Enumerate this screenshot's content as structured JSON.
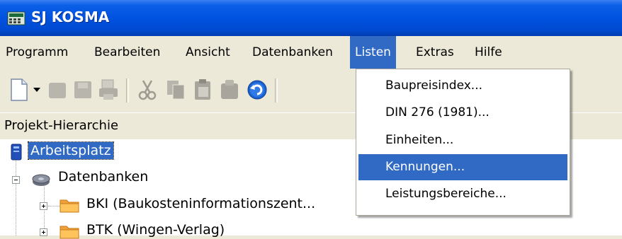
{
  "window": {
    "title": "SJ KOSMA"
  },
  "menubar": {
    "items": [
      {
        "label": "Programm"
      },
      {
        "label": "Bearbeiten"
      },
      {
        "label": "Ansicht"
      },
      {
        "label": "Datenbanken"
      },
      {
        "label": "Listen"
      },
      {
        "label": "Extras"
      },
      {
        "label": "Hilfe"
      }
    ],
    "active": "Listen"
  },
  "toolbar": {
    "icons": [
      "new-document-icon",
      "dropdown-arrow-icon",
      "disabled-icon",
      "disabled-icon",
      "disabled-icon",
      "cut-icon",
      "copy-icon",
      "paste-icon",
      "disabled-icon",
      "undo-icon"
    ]
  },
  "pane": {
    "title": "Projekt-Hierarchie"
  },
  "tree": {
    "items": [
      {
        "label": "Arbeitsplatz",
        "selected": true
      },
      {
        "label": "Datenbanken"
      },
      {
        "label": "BKI (Baukosteninformationszent..."
      },
      {
        "label": "BTK (Wingen-Verlag)"
      }
    ]
  },
  "listen_menu": {
    "items": [
      {
        "label": "Baupreisindex..."
      },
      {
        "label": "DIN 276 (1981)..."
      },
      {
        "label": "Einheiten..."
      },
      {
        "label": "Kennungen...",
        "highlighted": true
      },
      {
        "label": "Leistungsbereiche..."
      }
    ]
  },
  "colors": {
    "titlebar": "#0052e0",
    "menu_highlight": "#316ac5",
    "window_face": "#ece9d8"
  }
}
